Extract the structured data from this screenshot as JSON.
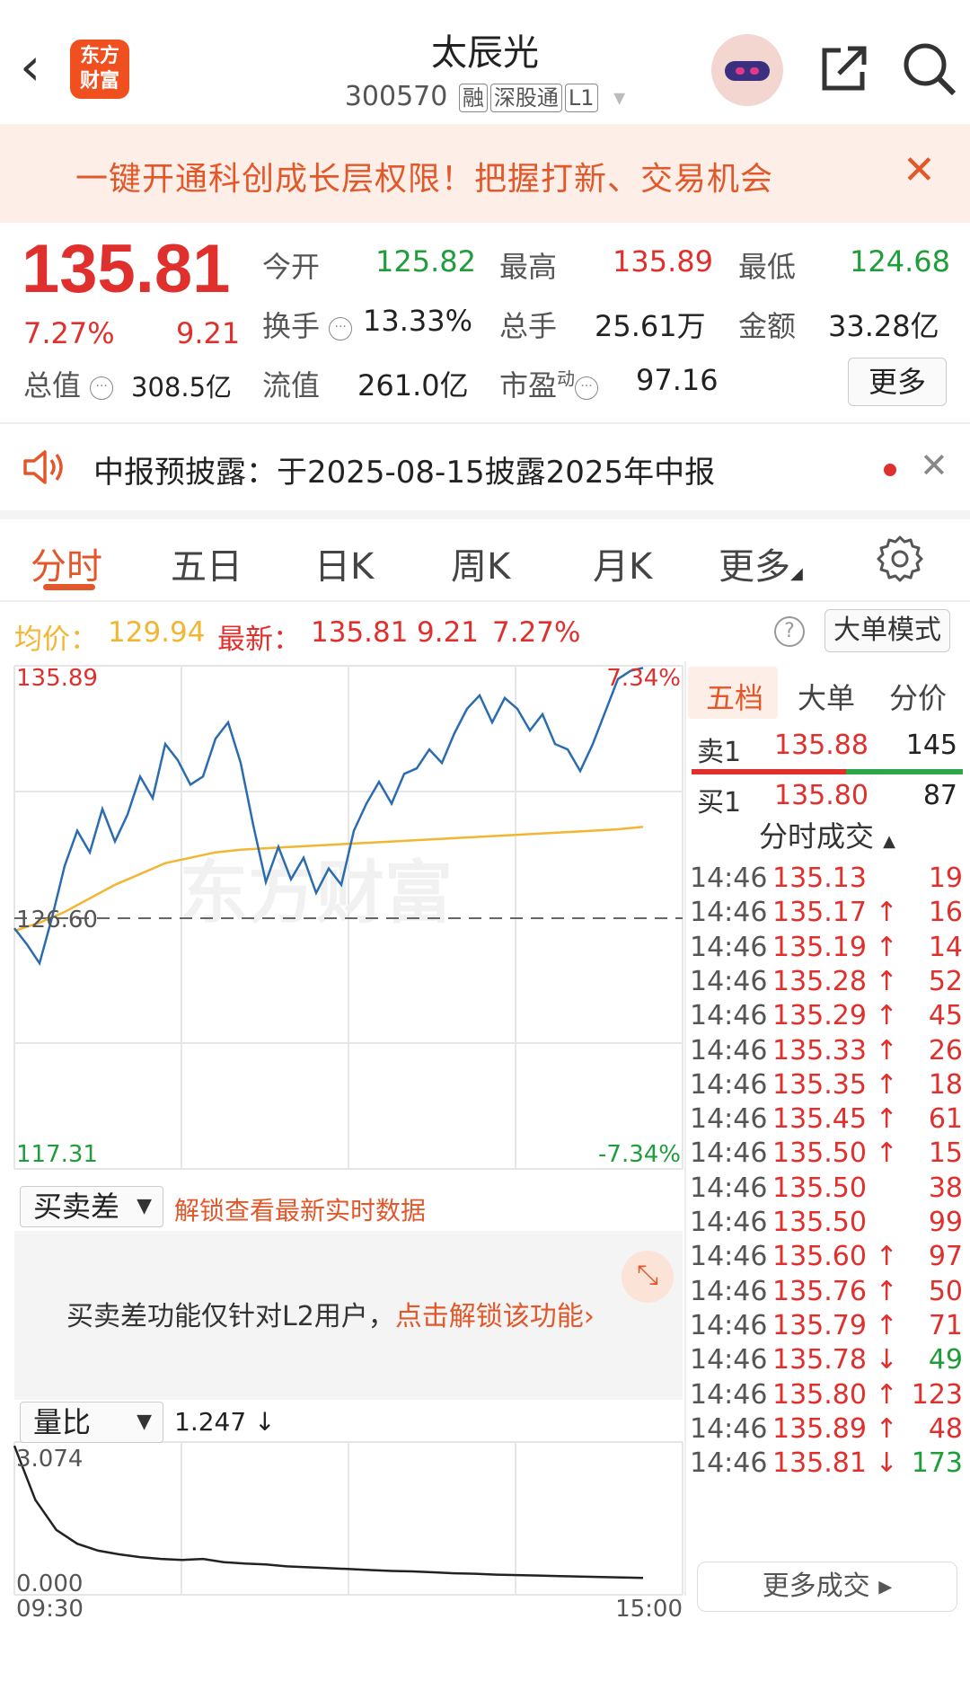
{
  "header": {
    "back_glyph": "‹",
    "logo_text_line1": "东方",
    "logo_text_line2": "财富",
    "title": "太辰光",
    "code": "300570",
    "tags": [
      "融",
      "深股通",
      "L1"
    ],
    "dropdown_glyph": "▾"
  },
  "banner": {
    "text": "一键开通科创成长层权限！把握打新、交易机会",
    "close_glyph": "✕"
  },
  "quote": {
    "price": "135.81",
    "change_pct": "7.27%",
    "change": "9.21",
    "open_label": "今开",
    "open": "125.82",
    "high_label": "最高",
    "high": "135.89",
    "low_label": "最低",
    "low": "124.68",
    "turnover_label": "换手",
    "turnover": "13.33%",
    "volume_label": "总手",
    "volume": "25.61万",
    "amount_label": "金额",
    "amount": "33.28亿",
    "mktcap_label": "总值",
    "mktcap": "308.5亿",
    "float_label": "流值",
    "float": "261.0亿",
    "pe_label": "市盈",
    "pe_sup": "动",
    "pe": "97.16",
    "more_label": "更多",
    "info_glyph": "···"
  },
  "notice": {
    "text": "中报预披露：于2025-08-15披露2025年中报",
    "close_glyph": "✕"
  },
  "tabs": [
    "分时",
    "五日",
    "日K",
    "周K",
    "月K",
    "更多"
  ],
  "avg_row": {
    "avg_label": "均价：",
    "avg": "129.94",
    "last_label": "最新：",
    "last": "135.81",
    "chg": "9.21",
    "pct": "7.27%",
    "help_glyph": "?",
    "mode_button": "大单模式"
  },
  "chart": {
    "y_max_label": "135.89",
    "y_mid_label": "126.60",
    "y_min_label": "117.31",
    "pct_max_label": "7.34%",
    "pct_min_label": "-7.34%",
    "watermark": "东方财富",
    "vol_max_label": "3.074",
    "vol_min_label": "0.000",
    "time_start": "09:30",
    "time_end": "15:00"
  },
  "chart_data": {
    "type": "line",
    "ylim": [
      117.31,
      135.89
    ],
    "prev_close": 126.6,
    "series": [
      {
        "name": "",
        "values": [
          126.2,
          125.6,
          124.9,
          126.6,
          128.5,
          129.8,
          129.0,
          130.6,
          129.4,
          130.4,
          131.8,
          131.0,
          133.0,
          132.4,
          131.5,
          131.8,
          133.2,
          133.8,
          132.3,
          130.0,
          127.9,
          129.2,
          128.0,
          128.8,
          127.5,
          128.4,
          127.8,
          129.8,
          130.8,
          131.6,
          130.8,
          131.9,
          132.1,
          132.8,
          132.3,
          133.4,
          134.3,
          134.8,
          133.8,
          134.7,
          134.3,
          133.5,
          134.1,
          133.0,
          132.8,
          132.0,
          133.0,
          134.2,
          135.4,
          135.7,
          135.81
        ]
      },
      {
        "name": "",
        "values": [
          126.1,
          126.4,
          126.8,
          127.3,
          127.8,
          128.2,
          128.6,
          128.8,
          129.0,
          129.1,
          129.15,
          129.2,
          129.25,
          129.3,
          129.35,
          129.4,
          129.45,
          129.5,
          129.55,
          129.6,
          129.65,
          129.7,
          129.75,
          129.8,
          129.85,
          129.94
        ]
      }
    ]
  },
  "volume_ratio": {
    "label": "量比",
    "value": "1.247",
    "trend_glyph": "↓",
    "ylim": [
      0,
      3.074
    ],
    "values": [
      3.07,
      1.9,
      1.25,
      0.95,
      0.8,
      0.72,
      0.66,
      0.62,
      0.6,
      0.62,
      0.55,
      0.52,
      0.5,
      0.46,
      0.44,
      0.42,
      0.4,
      0.38,
      0.36,
      0.35,
      0.33,
      0.31,
      0.3,
      0.28,
      0.27,
      0.26,
      0.25,
      0.24,
      0.23,
      0.22,
      0.21
    ]
  },
  "spread_panel": {
    "dropdown_label": "买卖差",
    "unlock_link": "解锁查看最新实时数据",
    "notice_prefix": "买卖差功能仅针对L2用户，",
    "notice_link": "点击解锁该功能",
    "expand_glyph": "⤡"
  },
  "orderbook": {
    "tabs": [
      "五档",
      "大单",
      "分价"
    ],
    "sell": {
      "label": "卖1",
      "price": "135.88",
      "vol": "145"
    },
    "buy": {
      "label": "买1",
      "price": "135.80",
      "vol": "87"
    },
    "trades_title": "分时成交",
    "trades_sort_glyph": "▲",
    "trades": [
      {
        "time": "14:46",
        "price": "135.13",
        "arrow": "",
        "vol": "19",
        "dir": "red"
      },
      {
        "time": "14:46",
        "price": "135.17",
        "arrow": "↑",
        "vol": "16",
        "dir": "red"
      },
      {
        "time": "14:46",
        "price": "135.19",
        "arrow": "↑",
        "vol": "14",
        "dir": "red"
      },
      {
        "time": "14:46",
        "price": "135.28",
        "arrow": "↑",
        "vol": "52",
        "dir": "red"
      },
      {
        "time": "14:46",
        "price": "135.29",
        "arrow": "↑",
        "vol": "45",
        "dir": "red"
      },
      {
        "time": "14:46",
        "price": "135.33",
        "arrow": "↑",
        "vol": "26",
        "dir": "red"
      },
      {
        "time": "14:46",
        "price": "135.35",
        "arrow": "↑",
        "vol": "18",
        "dir": "red"
      },
      {
        "time": "14:46",
        "price": "135.45",
        "arrow": "↑",
        "vol": "61",
        "dir": "red"
      },
      {
        "time": "14:46",
        "price": "135.50",
        "arrow": "↑",
        "vol": "15",
        "dir": "red"
      },
      {
        "time": "14:46",
        "price": "135.50",
        "arrow": "",
        "vol": "38",
        "dir": "red"
      },
      {
        "time": "14:46",
        "price": "135.50",
        "arrow": "",
        "vol": "99",
        "dir": "red"
      },
      {
        "time": "14:46",
        "price": "135.60",
        "arrow": "↑",
        "vol": "97",
        "dir": "red"
      },
      {
        "time": "14:46",
        "price": "135.76",
        "arrow": "↑",
        "vol": "50",
        "dir": "red"
      },
      {
        "time": "14:46",
        "price": "135.79",
        "arrow": "↑",
        "vol": "71",
        "dir": "red"
      },
      {
        "time": "14:46",
        "price": "135.78",
        "arrow": "↓",
        "vol": "49",
        "dir": "green"
      },
      {
        "time": "14:46",
        "price": "135.80",
        "arrow": "↑",
        "vol": "123",
        "dir": "red"
      },
      {
        "time": "14:46",
        "price": "135.89",
        "arrow": "↑",
        "vol": "48",
        "dir": "red"
      },
      {
        "time": "14:46",
        "price": "135.81",
        "arrow": "↓",
        "vol": "173",
        "dir": "green"
      }
    ],
    "more_trades": "更多成交 ▸"
  },
  "colors": {
    "up": "#e0302d",
    "down": "#1f9d3a",
    "accent": "#e2582a",
    "price_line": "#2b6cb0",
    "avg_line": "#f2b632"
  }
}
